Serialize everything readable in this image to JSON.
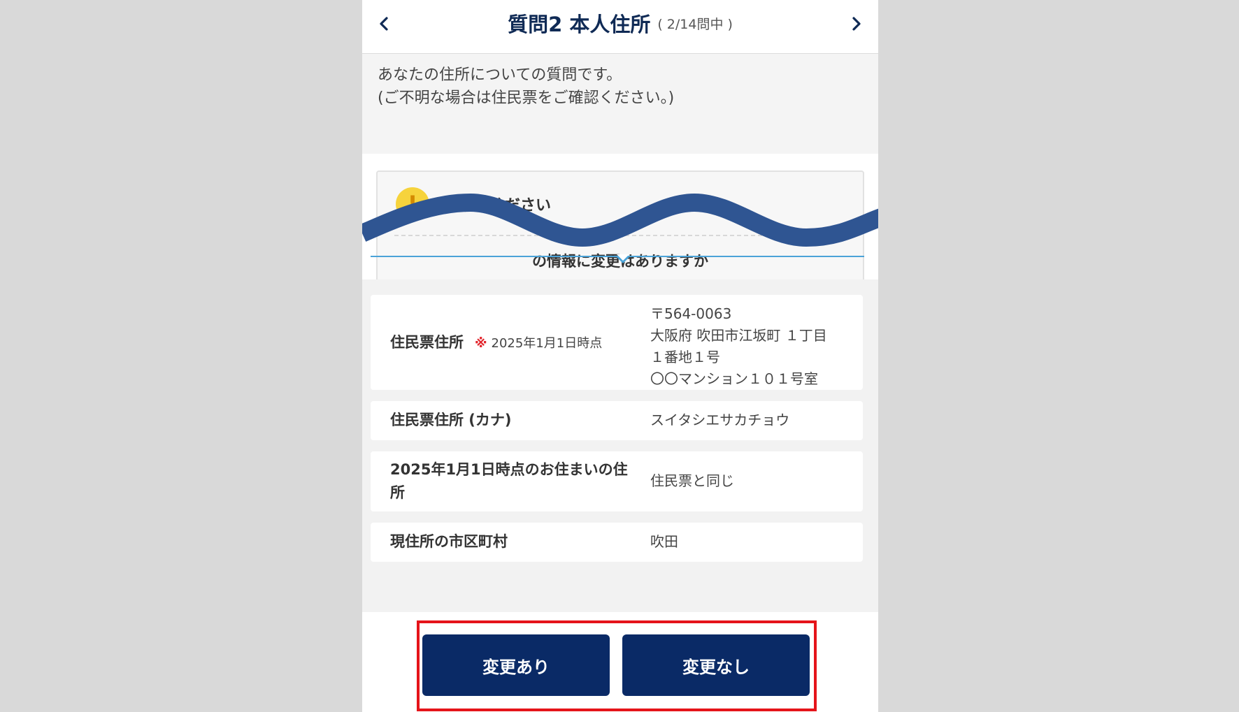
{
  "header": {
    "title": "質問2 本人住所",
    "progress": "( 2/14問中 )"
  },
  "intro": {
    "line1": "あなたの住所についての質問です。",
    "line2": "(ご不明な場合は住民票をご確認ください。)"
  },
  "notice": {
    "title": "お読みください",
    "text": "の情報に変更はありますか"
  },
  "rows": [
    {
      "label": "住民票住所",
      "note_mark": "※",
      "note": "2025年1月1日時点",
      "value_lines": [
        "〒564-0063",
        "大阪府 吹田市江坂町 １丁目",
        "１番地１号",
        "〇〇マンション１０１号室"
      ]
    },
    {
      "label": "住民票住所 (カナ)",
      "value": "スイタシエサカチョウ"
    },
    {
      "label_line1": "2025年1月1日時点のお住まいの住",
      "label_line2": "所",
      "value": "住民票と同じ"
    },
    {
      "label": "現住所の市区町村",
      "value": "吹田"
    }
  ],
  "buttons": {
    "change": "変更あり",
    "no_change": "変更なし"
  },
  "colors": {
    "primary": "#0a2a66",
    "title": "#0f2a55",
    "highlight": "#e5141a",
    "wave": "#2f5592",
    "accent_line": "#4ba3d8",
    "warning": "#f6d33c"
  }
}
